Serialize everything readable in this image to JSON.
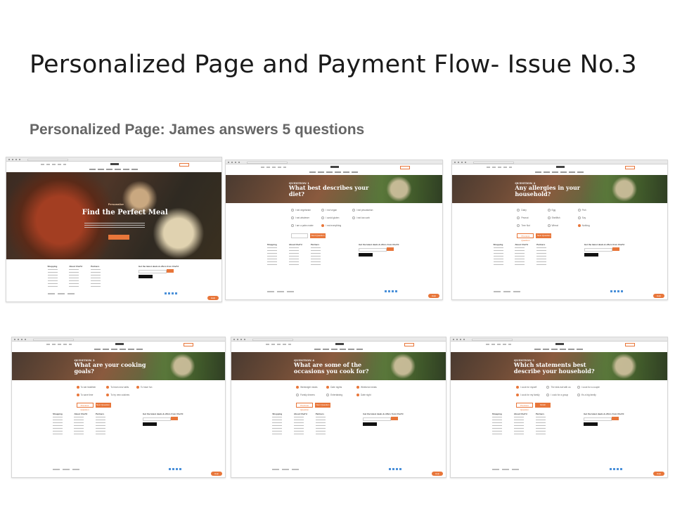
{
  "slide": {
    "title": "Personalized Page and Payment Flow- Issue No.3",
    "subtitle": "Personalized Page: James answers 5 questions"
  },
  "colors": {
    "accent": "#e8763a",
    "hero_overlay": "#4a3a30"
  },
  "site": {
    "logo_text": "CHEF'D",
    "login_label": "Sign Up",
    "help_label": "Help",
    "footer_headings": [
      "Shopping",
      "About Chef'd",
      "Partners"
    ],
    "signup_heading": "Get the latest deals & offers from Chef'd",
    "app_store_label": "App Store"
  },
  "screens": [
    {
      "kind": "landing",
      "kicker": "Personalize",
      "title": "Find the Perfect Meal",
      "button": "Get Started"
    },
    {
      "kind": "question",
      "label": "QUESTION 1",
      "question": "What best describes your diet?",
      "options": [
        "I eat vegetarian",
        "I eat vegan",
        "I eat pescatarian",
        "I eat whatever",
        "I avoid gluten",
        "I eat low carb",
        "I am a paleo eater",
        "I eat everything"
      ],
      "selected": [
        7
      ],
      "next": "Next Question"
    },
    {
      "kind": "question",
      "label": "QUESTION 2",
      "question": "Any allergies in your household?",
      "options": [
        "Dairy",
        "Egg",
        "Fish",
        "Peanut",
        "Shellfish",
        "Soy",
        "Tree Nut",
        "Wheat",
        "Nothing"
      ],
      "selected": [
        8
      ],
      "prev": "Previous Question",
      "next": "Next Question"
    },
    {
      "kind": "question",
      "label": "QUESTION 3",
      "question": "What are your cooking goals?",
      "options": [
        "To eat healthier",
        "To learn new skills",
        "To have fun",
        "To save time",
        "To try new cuisines"
      ],
      "selected": [
        0,
        1,
        2,
        3,
        4
      ],
      "prev": "Previous Question",
      "next": "Next Question"
    },
    {
      "kind": "question",
      "label": "QUESTION 4",
      "question": "What are some of the occasions you cook for?",
      "options": [
        "Weeknight meals",
        "Date nights",
        "Weekend meals",
        "Family dinners",
        "Entertaining",
        "Date night"
      ],
      "selected": [
        0,
        1,
        2,
        5
      ],
      "prev": "Previous Question",
      "next": "Next Question"
    },
    {
      "kind": "question",
      "label": "QUESTION 5",
      "question": "Which statements best describe your household?",
      "options": [
        "I cook for myself",
        "The kids eat with us",
        "I cook for a couple",
        "I cook for my family",
        "I cook for a group",
        "It's a big family"
      ],
      "selected": [
        0,
        3
      ],
      "prev": "Previous Question",
      "next": "Finish"
    }
  ]
}
